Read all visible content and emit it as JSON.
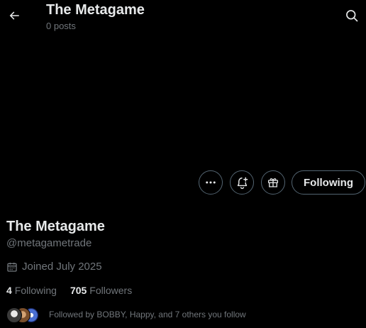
{
  "header": {
    "title": "The Metagame",
    "posts_count": "0 posts"
  },
  "actions": {
    "following_label": "Following"
  },
  "profile": {
    "display_name": "The Metagame",
    "handle": "@metagametrade",
    "joined": "Joined July 2025",
    "following_count": "4",
    "following_label": "Following",
    "followers_count": "705",
    "followers_label": "Followers",
    "followed_by_text": "Followed by BOBBY, Happy, and 7 others you follow"
  },
  "colors": {
    "background": "#000000",
    "primary_text": "#e7e9ea",
    "secondary_text": "#71767b",
    "border": "#536471"
  }
}
